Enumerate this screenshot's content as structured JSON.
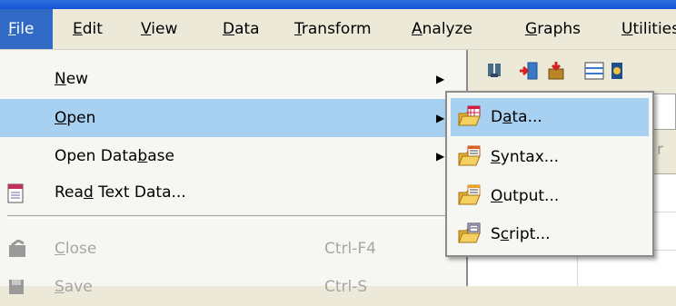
{
  "menubar": {
    "items": [
      {
        "label": "File",
        "u": "F"
      },
      {
        "label": "Edit",
        "u": "E"
      },
      {
        "label": "View",
        "u": "V"
      },
      {
        "label": "Data",
        "u": "D"
      },
      {
        "label": "Transform",
        "u": "T"
      },
      {
        "label": "Analyze",
        "u": "A"
      },
      {
        "label": "Graphs",
        "u": "G"
      },
      {
        "label": "Utilities",
        "u": "U"
      }
    ]
  },
  "file_menu": {
    "items": [
      {
        "pre": "",
        "u": "N",
        "post": "ew",
        "shortcut": "",
        "submenu": true,
        "state": "normal"
      },
      {
        "pre": "",
        "u": "O",
        "post": "pen",
        "shortcut": "",
        "submenu": true,
        "state": "highlighted"
      },
      {
        "pre": "Open Data",
        "u": "b",
        "post": "ase",
        "shortcut": "",
        "submenu": true,
        "state": "normal"
      },
      {
        "pre": "Rea",
        "u": "d",
        "post": " Text Data...",
        "shortcut": "",
        "submenu": false,
        "state": "normal",
        "icon": "text-data-icon"
      },
      {
        "pre": "",
        "u": "C",
        "post": "lose",
        "shortcut": "Ctrl-F4",
        "submenu": false,
        "state": "disabled",
        "icon": "close-doc-icon"
      },
      {
        "pre": "",
        "u": "S",
        "post": "ave",
        "shortcut": "Ctrl-S",
        "submenu": false,
        "state": "disabled",
        "icon": "save-icon"
      }
    ]
  },
  "open_submenu": {
    "items": [
      {
        "pre": "D",
        "u": "a",
        "post": "ta...",
        "icon": "open-data-icon",
        "state": "highlighted"
      },
      {
        "pre": "",
        "u": "S",
        "post": "yntax...",
        "icon": "open-syntax-icon",
        "state": "normal"
      },
      {
        "pre": "",
        "u": "O",
        "post": "utput...",
        "icon": "open-output-icon",
        "state": "normal"
      },
      {
        "pre": "S",
        "u": "c",
        "post": "ript...",
        "icon": "open-script-icon",
        "state": "normal"
      }
    ]
  },
  "background": {
    "grid_header_partial": "r"
  }
}
